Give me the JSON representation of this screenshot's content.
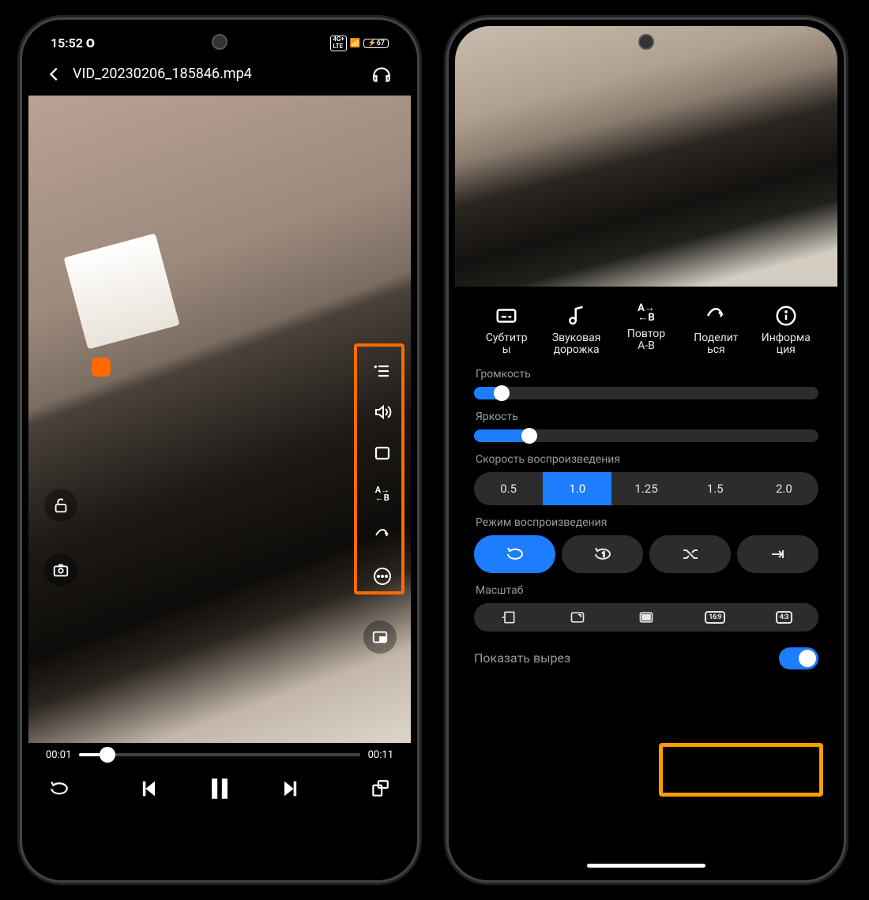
{
  "phone1": {
    "status": {
      "time": "15:52",
      "network": "4G+",
      "battery": "67"
    },
    "title": "VID_20230206_185846.mp4",
    "transport": {
      "current": "00:01",
      "duration": "00:11",
      "progress_pct": 10
    }
  },
  "phone2": {
    "options": [
      {
        "id": "subtitles",
        "line1": "Субтитр",
        "line2": "ы"
      },
      {
        "id": "audiotrack",
        "line1": "Звуковая",
        "line2": "дорожка"
      },
      {
        "id": "ab-repeat",
        "line1": "Повтор",
        "line2": "A-B"
      },
      {
        "id": "share",
        "line1": "Поделит",
        "line2": "ься"
      },
      {
        "id": "info",
        "line1": "Информа",
        "line2": "ция"
      }
    ],
    "sections": {
      "volume": {
        "label": "Громкость",
        "pct": 8
      },
      "brightness": {
        "label": "Яркость",
        "pct": 16
      },
      "speed": {
        "label": "Скорость воспроизведения",
        "values": [
          "0.5",
          "1.0",
          "1.25",
          "1.5",
          "2.0"
        ],
        "active": "1.0"
      },
      "mode": {
        "label": "Режим воспроизведения",
        "active_index": 0
      },
      "scale": {
        "label": "Масштаб",
        "r1": "16:9",
        "r2": "4:3"
      },
      "cutout": {
        "label": "Показать вырез",
        "on": true
      }
    }
  }
}
